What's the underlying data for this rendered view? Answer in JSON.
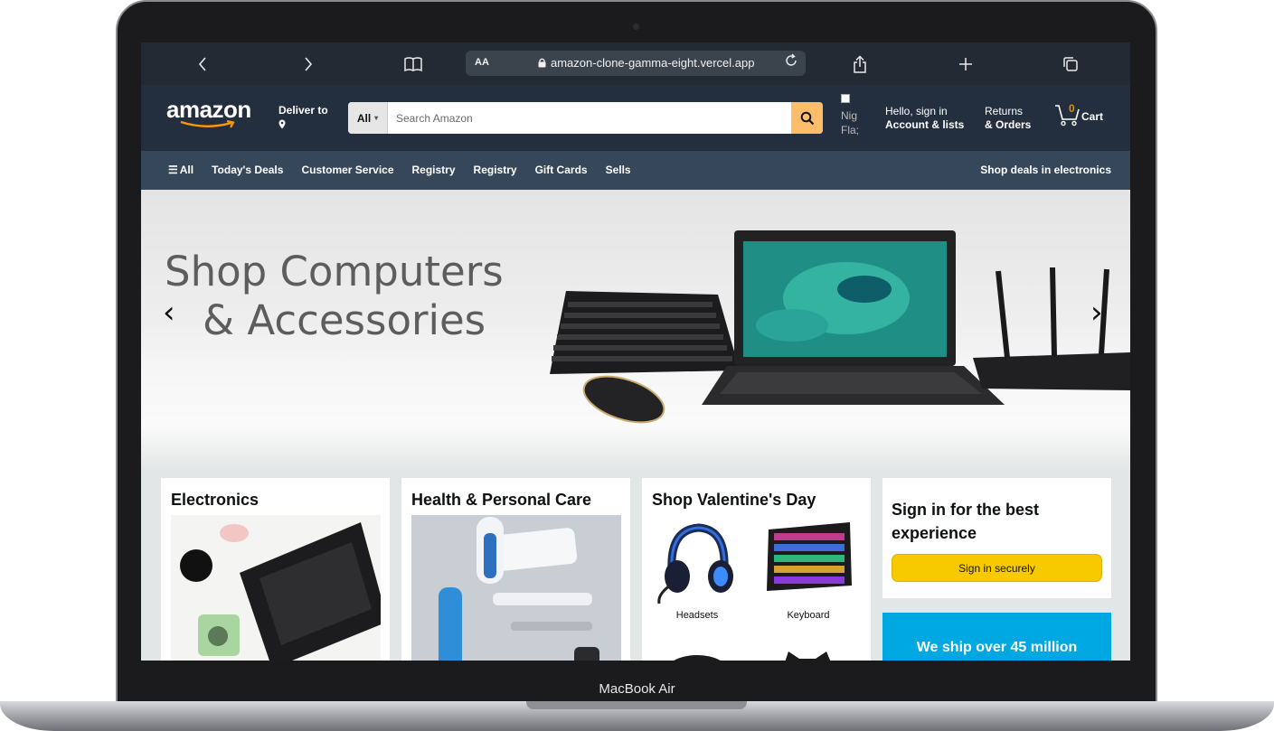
{
  "device": {
    "model_label": "MacBook Air"
  },
  "browser": {
    "url": "amazon-clone-gamma-eight.vercel.app",
    "text_size_label": "AA",
    "back_icon": "chevron-left-icon",
    "forward_icon": "chevron-right-icon",
    "bookmarks_icon": "book-icon",
    "reload_icon": "reload-icon",
    "share_icon": "share-icon",
    "new_tab_icon": "plus-icon",
    "tabs_icon": "tabs-icon"
  },
  "header": {
    "logo": "amazon",
    "deliver_to": "Deliver to",
    "search": {
      "category": "All",
      "placeholder": "Search Amazon"
    },
    "flag_alt": "Nig Fla;",
    "account": {
      "line1": "Hello, sign in",
      "line2": "Account & lists"
    },
    "returns": {
      "line1": "Returns",
      "line2": "& Orders"
    },
    "cart": {
      "count": "0",
      "label": "Cart"
    }
  },
  "subnav": {
    "items": [
      "All",
      "Today's Deals",
      "Customer Service",
      "Registry",
      "Registry",
      "Gift Cards",
      "Sells"
    ],
    "right": "Shop deals in electronics"
  },
  "hero": {
    "line1": "Shop Computers",
    "line2": "& Accessories"
  },
  "cards": {
    "electronics": {
      "title": "Electronics"
    },
    "health": {
      "title": "Health & Personal Care"
    },
    "valentine": {
      "title": "Shop Valentine's Day",
      "items": [
        "Headsets",
        "Keyboard"
      ]
    },
    "signin": {
      "title": "Sign in for the best experience",
      "button": "Sign in securely"
    },
    "ship": {
      "text": "We ship over 45 million"
    }
  },
  "colors": {
    "header_bg": "#232f3e",
    "subnav_bg": "#37475a",
    "search_button": "#febd69",
    "signin_button": "#f7ca00",
    "cart_count": "#f08804",
    "ship_card": "#00a8e1"
  }
}
